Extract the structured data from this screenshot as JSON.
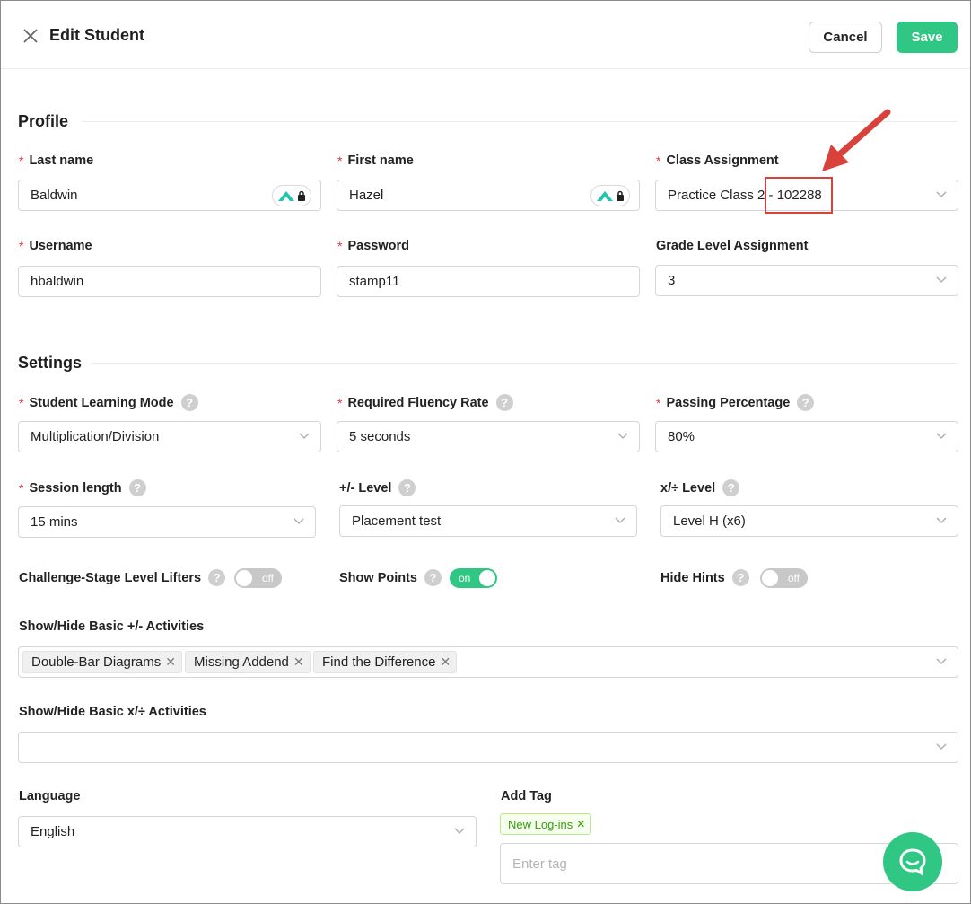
{
  "header": {
    "title": "Edit Student",
    "cancel_label": "Cancel",
    "save_label": "Save"
  },
  "profile": {
    "section_title": "Profile",
    "last_name": {
      "label": "Last name",
      "value": "Baldwin"
    },
    "first_name": {
      "label": "First name",
      "value": "Hazel"
    },
    "class_assignment": {
      "label": "Class Assignment",
      "value": "Practice Class 2 - 102288"
    },
    "username": {
      "label": "Username",
      "value": "hbaldwin"
    },
    "password": {
      "label": "Password",
      "value": "stamp11"
    },
    "grade_level": {
      "label": "Grade Level Assignment",
      "value": "3"
    }
  },
  "settings": {
    "section_title": "Settings",
    "learning_mode": {
      "label": "Student Learning Mode",
      "value": "Multiplication/Division"
    },
    "fluency_rate": {
      "label": "Required Fluency Rate",
      "value": "5 seconds"
    },
    "passing_percentage": {
      "label": "Passing Percentage",
      "value": "80%"
    },
    "session_length": {
      "label": "Session length",
      "value": "15 mins"
    },
    "add_sub_level": {
      "label": "+/- Level",
      "value": "Placement test"
    },
    "mul_div_level": {
      "label": "x/÷ Level",
      "value": "Level H (x6)"
    },
    "level_lifters": {
      "label": "Challenge-Stage Level Lifters",
      "state": "off"
    },
    "show_points": {
      "label": "Show Points",
      "state": "on"
    },
    "hide_hints": {
      "label": "Hide Hints",
      "state": "off"
    },
    "basic_add_sub": {
      "label": "Show/Hide Basic +/- Activities",
      "chips": [
        "Double-Bar Diagrams",
        "Missing Addend",
        "Find the Difference"
      ]
    },
    "basic_mul_div": {
      "label": "Show/Hide Basic x/÷ Activities"
    },
    "language": {
      "label": "Language",
      "value": "English"
    },
    "add_tag": {
      "label": "Add Tag",
      "tag": "New Log-ins",
      "placeholder": "Enter tag"
    }
  },
  "help_glyph": "?",
  "colors": {
    "accent": "#2fc783",
    "required": "#e0383e",
    "annotation": "#d9413b"
  }
}
